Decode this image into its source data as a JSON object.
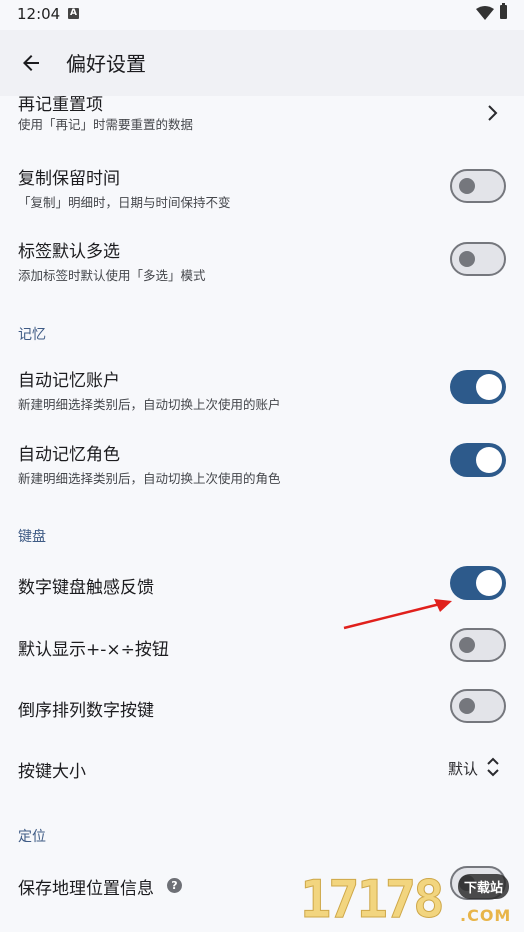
{
  "status_bar": {
    "time": "12:04",
    "notif_badge": "A"
  },
  "app_bar": {
    "title": "偏好设置"
  },
  "items": {
    "reset": {
      "title": "再记重置项",
      "subtitle": "使用「再记」时需要重置的数据"
    },
    "copy_keep_time": {
      "title": "复制保留时间",
      "subtitle": "「复制」明细时，日期与时间保持不变",
      "checked": false
    },
    "tag_multi": {
      "title": "标签默认多选",
      "subtitle": "添加标签时默认使用「多选」模式",
      "checked": false
    }
  },
  "sections": {
    "memory": {
      "header": "记忆",
      "auto_account": {
        "title": "自动记忆账户",
        "subtitle": "新建明细选择类别后，自动切换上次使用的账户",
        "checked": true
      },
      "auto_role": {
        "title": "自动记忆角色",
        "subtitle": "新建明细选择类别后，自动切换上次使用的角色",
        "checked": true
      }
    },
    "keyboard": {
      "header": "键盘",
      "haptic": {
        "title": "数字键盘触感反馈",
        "checked": true
      },
      "show_ops": {
        "title": "默认显示+-×÷按钮",
        "checked": false
      },
      "reverse": {
        "title": "倒序排列数字按键",
        "checked": false
      },
      "key_size": {
        "title": "按键大小",
        "value": "默认"
      }
    },
    "location": {
      "header": "定位",
      "save_location": {
        "title": "保存地理位置信息",
        "help_glyph": "?",
        "checked": false
      }
    }
  },
  "watermark": {
    "digits": "17178",
    "badge": "下载站",
    "domain": ".COM"
  },
  "colors": {
    "accent": "#2d5a8b",
    "section_header": "#3f5b85",
    "background": "#f7f8fb",
    "annotation_arrow": "#e0201c"
  }
}
